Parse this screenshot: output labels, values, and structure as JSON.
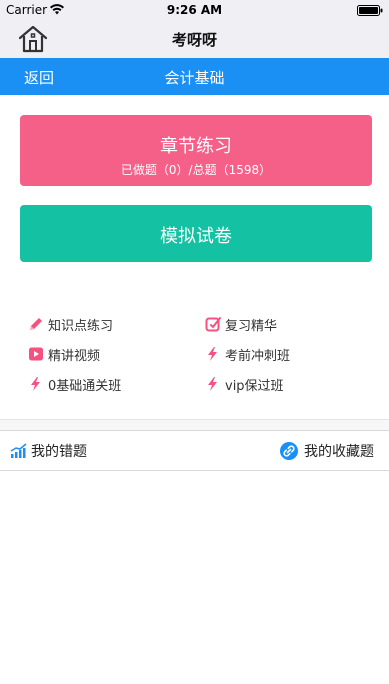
{
  "status_bar": {
    "carrier": "Carrier",
    "time": "9:26 AM"
  },
  "header": {
    "title": "考呀呀",
    "home_icon": "home-icon"
  },
  "nav": {
    "back_label": "返回",
    "title": "会计基础",
    "color": "#1a90f5"
  },
  "chapter_practice": {
    "title": "章节练习",
    "subtitle": "已做题（0）/总题（1598）",
    "color": "#f56089"
  },
  "mock_exam": {
    "title": "模拟试卷",
    "color": "#14c2a3"
  },
  "features": [
    {
      "label": "知识点练习",
      "icon": "pencil-icon"
    },
    {
      "label": "复习精华",
      "icon": "edit-icon"
    },
    {
      "label": "精讲视频",
      "icon": "video-icon"
    },
    {
      "label": "考前冲刺班",
      "icon": "lightning-icon"
    },
    {
      "label": "0基础通关班",
      "icon": "lightning-icon"
    },
    {
      "label": "vip保过班",
      "icon": "lightning-icon"
    }
  ],
  "bottom": {
    "wrong_label": "我的错题",
    "wrong_icon": "chart-icon",
    "fav_label": "我的收藏题",
    "fav_icon": "link-icon"
  }
}
